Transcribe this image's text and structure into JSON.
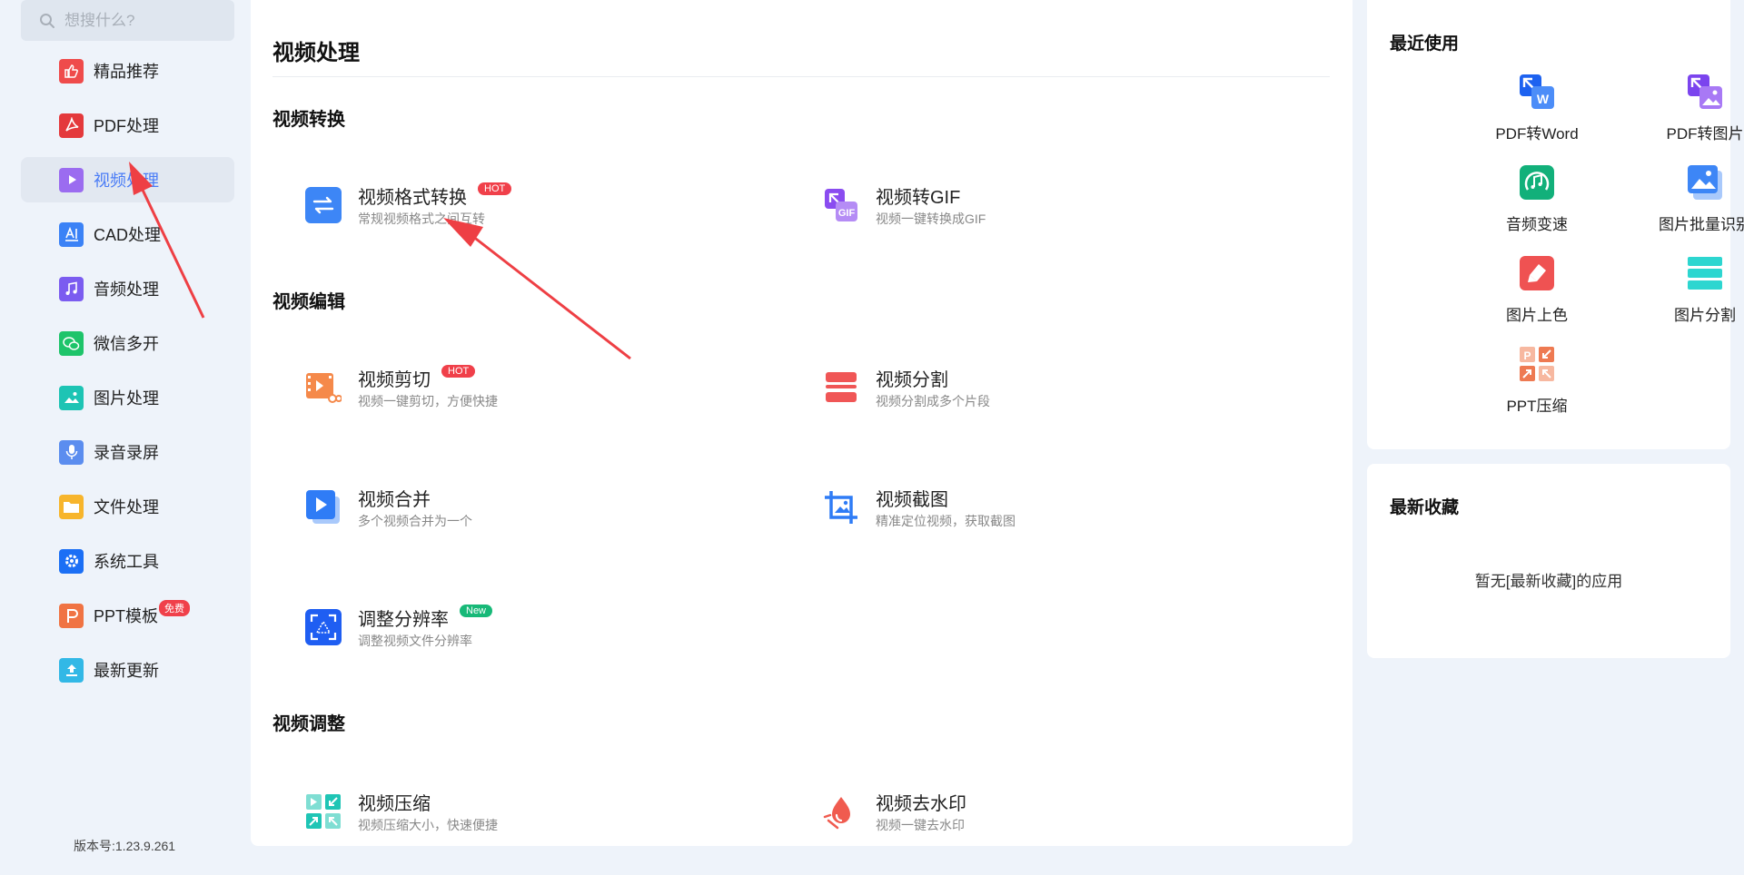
{
  "search": {
    "placeholder": "想搜什么?"
  },
  "sidebar": {
    "items": [
      {
        "label": "精品推荐",
        "icon": "thumbs-up-icon",
        "color": "#ef4b4b"
      },
      {
        "label": "PDF处理",
        "icon": "pdf-icon",
        "color": "#e4393c"
      },
      {
        "label": "视频处理",
        "icon": "play-icon",
        "color": "#9b6cf0"
      },
      {
        "label": "CAD处理",
        "icon": "cad-icon",
        "color": "#3b82f6"
      },
      {
        "label": "音频处理",
        "icon": "music-note-icon",
        "color": "#7b5cf0"
      },
      {
        "label": "微信多开",
        "icon": "wechat-icon",
        "color": "#1ec46a"
      },
      {
        "label": "图片处理",
        "icon": "image-icon",
        "color": "#1dc4b4"
      },
      {
        "label": "录音录屏",
        "icon": "microphone-icon",
        "color": "#5b8def"
      },
      {
        "label": "文件处理",
        "icon": "folder-icon",
        "color": "#f7b52c"
      },
      {
        "label": "系统工具",
        "icon": "gear-icon",
        "color": "#1b6ff5"
      },
      {
        "label": "PPT模板",
        "icon": "ppt-icon",
        "color": "#f07343",
        "badge": "免费"
      },
      {
        "label": "最新更新",
        "icon": "upload-icon",
        "color": "#32b8e6"
      }
    ],
    "active_index": 2,
    "version": "版本号:1.23.9.261"
  },
  "main": {
    "title": "视频处理",
    "sections": [
      {
        "title": "视频转换"
      },
      {
        "title": "视频编辑"
      },
      {
        "title": "视频调整"
      }
    ],
    "tools": {
      "format_convert": {
        "name": "视频格式转换",
        "desc": "常规视频格式之间互转",
        "badge": "HOT"
      },
      "to_gif": {
        "name": "视频转GIF",
        "desc": "视频一键转换成GIF"
      },
      "cut": {
        "name": "视频剪切",
        "desc": "视频一键剪切，方便快捷",
        "badge": "HOT"
      },
      "split": {
        "name": "视频分割",
        "desc": "视频分割成多个片段"
      },
      "merge": {
        "name": "视频合并",
        "desc": "多个视频合并为一个"
      },
      "screenshot": {
        "name": "视频截图",
        "desc": "精准定位视频，获取截图"
      },
      "resolution": {
        "name": "调整分辨率",
        "desc": "调整视频文件分辨率",
        "badge": "New"
      },
      "compress": {
        "name": "视频压缩",
        "desc": "视频压缩大小，快速便捷"
      },
      "watermark": {
        "name": "视频去水印",
        "desc": "视频一键去水印"
      }
    }
  },
  "recent": {
    "title": "最近使用",
    "items": [
      {
        "label": "PDF转Word",
        "icon": "pdf-to-word-icon"
      },
      {
        "label": "PDF转图片",
        "icon": "pdf-to-image-icon"
      },
      {
        "label": "音频变速",
        "icon": "audio-speed-icon"
      },
      {
        "label": "图片批量识别",
        "icon": "image-batch-ocr-icon"
      },
      {
        "label": "图片上色",
        "icon": "image-colorize-icon"
      },
      {
        "label": "图片分割",
        "icon": "image-split-icon"
      },
      {
        "label": "PPT压缩",
        "icon": "ppt-compress-icon"
      }
    ]
  },
  "favorites": {
    "title": "最新收藏",
    "empty_text": "暂无[最新收藏]的应用"
  },
  "colors": {
    "accent": "#4a7cf6",
    "hot": "#f0404a",
    "new": "#17b978",
    "annotation_arrow": "#ee3f44"
  }
}
